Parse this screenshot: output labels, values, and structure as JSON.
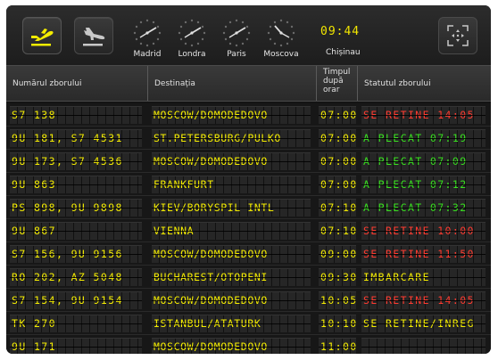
{
  "colors": {
    "yellow": "#f4ec00",
    "green": "#38e11f",
    "red": "#ff3b30"
  },
  "toolbar": {
    "departures_icon": "plane-departure-icon",
    "arrivals_icon": "plane-arrival-icon",
    "fullscreen_icon": "fullscreen-icon"
  },
  "clocks": [
    {
      "city": "Madrid"
    },
    {
      "city": "Londra"
    },
    {
      "city": "Paris"
    },
    {
      "city": "Moscova"
    }
  ],
  "local": {
    "time": "09:44",
    "city": "Chișinau"
  },
  "columns": {
    "flight": "Numărul zborului",
    "destination": "Destinația",
    "time": "Timpul\ndupă\norar",
    "status": "Statutul zborului"
  },
  "flights": [
    {
      "flight": "S7 138",
      "destination": "MOSCOW/DOMODEDOVO",
      "time": "07:00",
      "status": "SE RETINE 14:05",
      "status_color": "red"
    },
    {
      "flight": "9U 181, S7 4531",
      "destination": "ST.PETERSBURG/PULKO",
      "time": "07:00",
      "status": "A PLECAT 07:19",
      "status_color": "green"
    },
    {
      "flight": "9U 173, S7 4536",
      "destination": "MOSCOW/DOMODEDOVO",
      "time": "07:00",
      "status": "A PLECAT 07:09",
      "status_color": "green"
    },
    {
      "flight": "9U 863",
      "destination": "FRANKFURT",
      "time": "07:00",
      "status": "A PLECAT 07:12",
      "status_color": "green"
    },
    {
      "flight": "PS 898, 9U 9898",
      "destination": "KIEV/BORYSPIL INTL",
      "time": "07:10",
      "status": "A PLECAT 07:32",
      "status_color": "green"
    },
    {
      "flight": "9U 867",
      "destination": "VIENNA",
      "time": "07:10",
      "status": "SE RETINE 10:00",
      "status_color": "red"
    },
    {
      "flight": "S7 156, 9U 9156",
      "destination": "MOSCOW/DOMODEDOVO",
      "time": "09:00",
      "status": "SE RETINE 11:50",
      "status_color": "red"
    },
    {
      "flight": "RO 202, AZ 5048",
      "destination": "BUCHAREST/OTOPENI",
      "time": "09:30",
      "status": "IMBARCARE",
      "status_color": "yellow"
    },
    {
      "flight": "S7 154, 9U 9154",
      "destination": "MOSCOW/DOMODEDOVO",
      "time": "10:05",
      "status": "SE RETINE 14:05",
      "status_color": "red"
    },
    {
      "flight": "TK 270",
      "destination": "ISTANBUL/ATATURK",
      "time": "10:10",
      "status": "SE RETINE/INREG",
      "status_color": "yellow"
    },
    {
      "flight": "9U 171",
      "destination": "MOSCOW/DOMODEDOVO",
      "time": "11:00",
      "status": "",
      "status_color": "yellow"
    }
  ]
}
